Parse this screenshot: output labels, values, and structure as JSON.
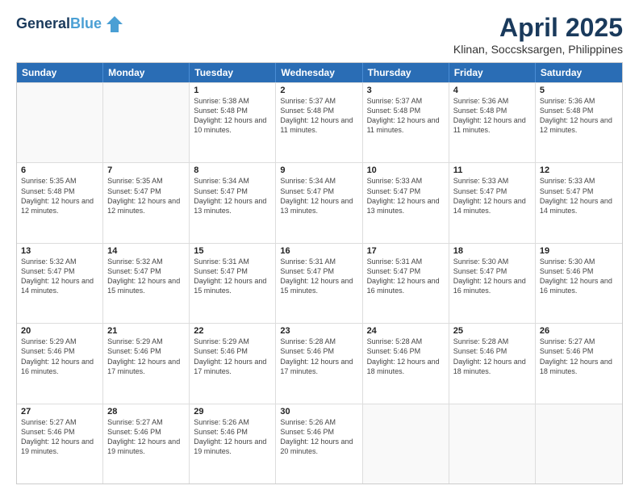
{
  "logo": {
    "line1": "General",
    "line2": "Blue"
  },
  "header": {
    "title": "April 2025",
    "subtitle": "Klinan, Soccsksargen, Philippines"
  },
  "weekdays": [
    "Sunday",
    "Monday",
    "Tuesday",
    "Wednesday",
    "Thursday",
    "Friday",
    "Saturday"
  ],
  "weeks": [
    [
      {
        "day": "",
        "info": ""
      },
      {
        "day": "",
        "info": ""
      },
      {
        "day": "1",
        "info": "Sunrise: 5:38 AM\nSunset: 5:48 PM\nDaylight: 12 hours and 10 minutes."
      },
      {
        "day": "2",
        "info": "Sunrise: 5:37 AM\nSunset: 5:48 PM\nDaylight: 12 hours and 11 minutes."
      },
      {
        "day": "3",
        "info": "Sunrise: 5:37 AM\nSunset: 5:48 PM\nDaylight: 12 hours and 11 minutes."
      },
      {
        "day": "4",
        "info": "Sunrise: 5:36 AM\nSunset: 5:48 PM\nDaylight: 12 hours and 11 minutes."
      },
      {
        "day": "5",
        "info": "Sunrise: 5:36 AM\nSunset: 5:48 PM\nDaylight: 12 hours and 12 minutes."
      }
    ],
    [
      {
        "day": "6",
        "info": "Sunrise: 5:35 AM\nSunset: 5:48 PM\nDaylight: 12 hours and 12 minutes."
      },
      {
        "day": "7",
        "info": "Sunrise: 5:35 AM\nSunset: 5:47 PM\nDaylight: 12 hours and 12 minutes."
      },
      {
        "day": "8",
        "info": "Sunrise: 5:34 AM\nSunset: 5:47 PM\nDaylight: 12 hours and 13 minutes."
      },
      {
        "day": "9",
        "info": "Sunrise: 5:34 AM\nSunset: 5:47 PM\nDaylight: 12 hours and 13 minutes."
      },
      {
        "day": "10",
        "info": "Sunrise: 5:33 AM\nSunset: 5:47 PM\nDaylight: 12 hours and 13 minutes."
      },
      {
        "day": "11",
        "info": "Sunrise: 5:33 AM\nSunset: 5:47 PM\nDaylight: 12 hours and 14 minutes."
      },
      {
        "day": "12",
        "info": "Sunrise: 5:33 AM\nSunset: 5:47 PM\nDaylight: 12 hours and 14 minutes."
      }
    ],
    [
      {
        "day": "13",
        "info": "Sunrise: 5:32 AM\nSunset: 5:47 PM\nDaylight: 12 hours and 14 minutes."
      },
      {
        "day": "14",
        "info": "Sunrise: 5:32 AM\nSunset: 5:47 PM\nDaylight: 12 hours and 15 minutes."
      },
      {
        "day": "15",
        "info": "Sunrise: 5:31 AM\nSunset: 5:47 PM\nDaylight: 12 hours and 15 minutes."
      },
      {
        "day": "16",
        "info": "Sunrise: 5:31 AM\nSunset: 5:47 PM\nDaylight: 12 hours and 15 minutes."
      },
      {
        "day": "17",
        "info": "Sunrise: 5:31 AM\nSunset: 5:47 PM\nDaylight: 12 hours and 16 minutes."
      },
      {
        "day": "18",
        "info": "Sunrise: 5:30 AM\nSunset: 5:47 PM\nDaylight: 12 hours and 16 minutes."
      },
      {
        "day": "19",
        "info": "Sunrise: 5:30 AM\nSunset: 5:46 PM\nDaylight: 12 hours and 16 minutes."
      }
    ],
    [
      {
        "day": "20",
        "info": "Sunrise: 5:29 AM\nSunset: 5:46 PM\nDaylight: 12 hours and 16 minutes."
      },
      {
        "day": "21",
        "info": "Sunrise: 5:29 AM\nSunset: 5:46 PM\nDaylight: 12 hours and 17 minutes."
      },
      {
        "day": "22",
        "info": "Sunrise: 5:29 AM\nSunset: 5:46 PM\nDaylight: 12 hours and 17 minutes."
      },
      {
        "day": "23",
        "info": "Sunrise: 5:28 AM\nSunset: 5:46 PM\nDaylight: 12 hours and 17 minutes."
      },
      {
        "day": "24",
        "info": "Sunrise: 5:28 AM\nSunset: 5:46 PM\nDaylight: 12 hours and 18 minutes."
      },
      {
        "day": "25",
        "info": "Sunrise: 5:28 AM\nSunset: 5:46 PM\nDaylight: 12 hours and 18 minutes."
      },
      {
        "day": "26",
        "info": "Sunrise: 5:27 AM\nSunset: 5:46 PM\nDaylight: 12 hours and 18 minutes."
      }
    ],
    [
      {
        "day": "27",
        "info": "Sunrise: 5:27 AM\nSunset: 5:46 PM\nDaylight: 12 hours and 19 minutes."
      },
      {
        "day": "28",
        "info": "Sunrise: 5:27 AM\nSunset: 5:46 PM\nDaylight: 12 hours and 19 minutes."
      },
      {
        "day": "29",
        "info": "Sunrise: 5:26 AM\nSunset: 5:46 PM\nDaylight: 12 hours and 19 minutes."
      },
      {
        "day": "30",
        "info": "Sunrise: 5:26 AM\nSunset: 5:46 PM\nDaylight: 12 hours and 20 minutes."
      },
      {
        "day": "",
        "info": ""
      },
      {
        "day": "",
        "info": ""
      },
      {
        "day": "",
        "info": ""
      }
    ]
  ]
}
